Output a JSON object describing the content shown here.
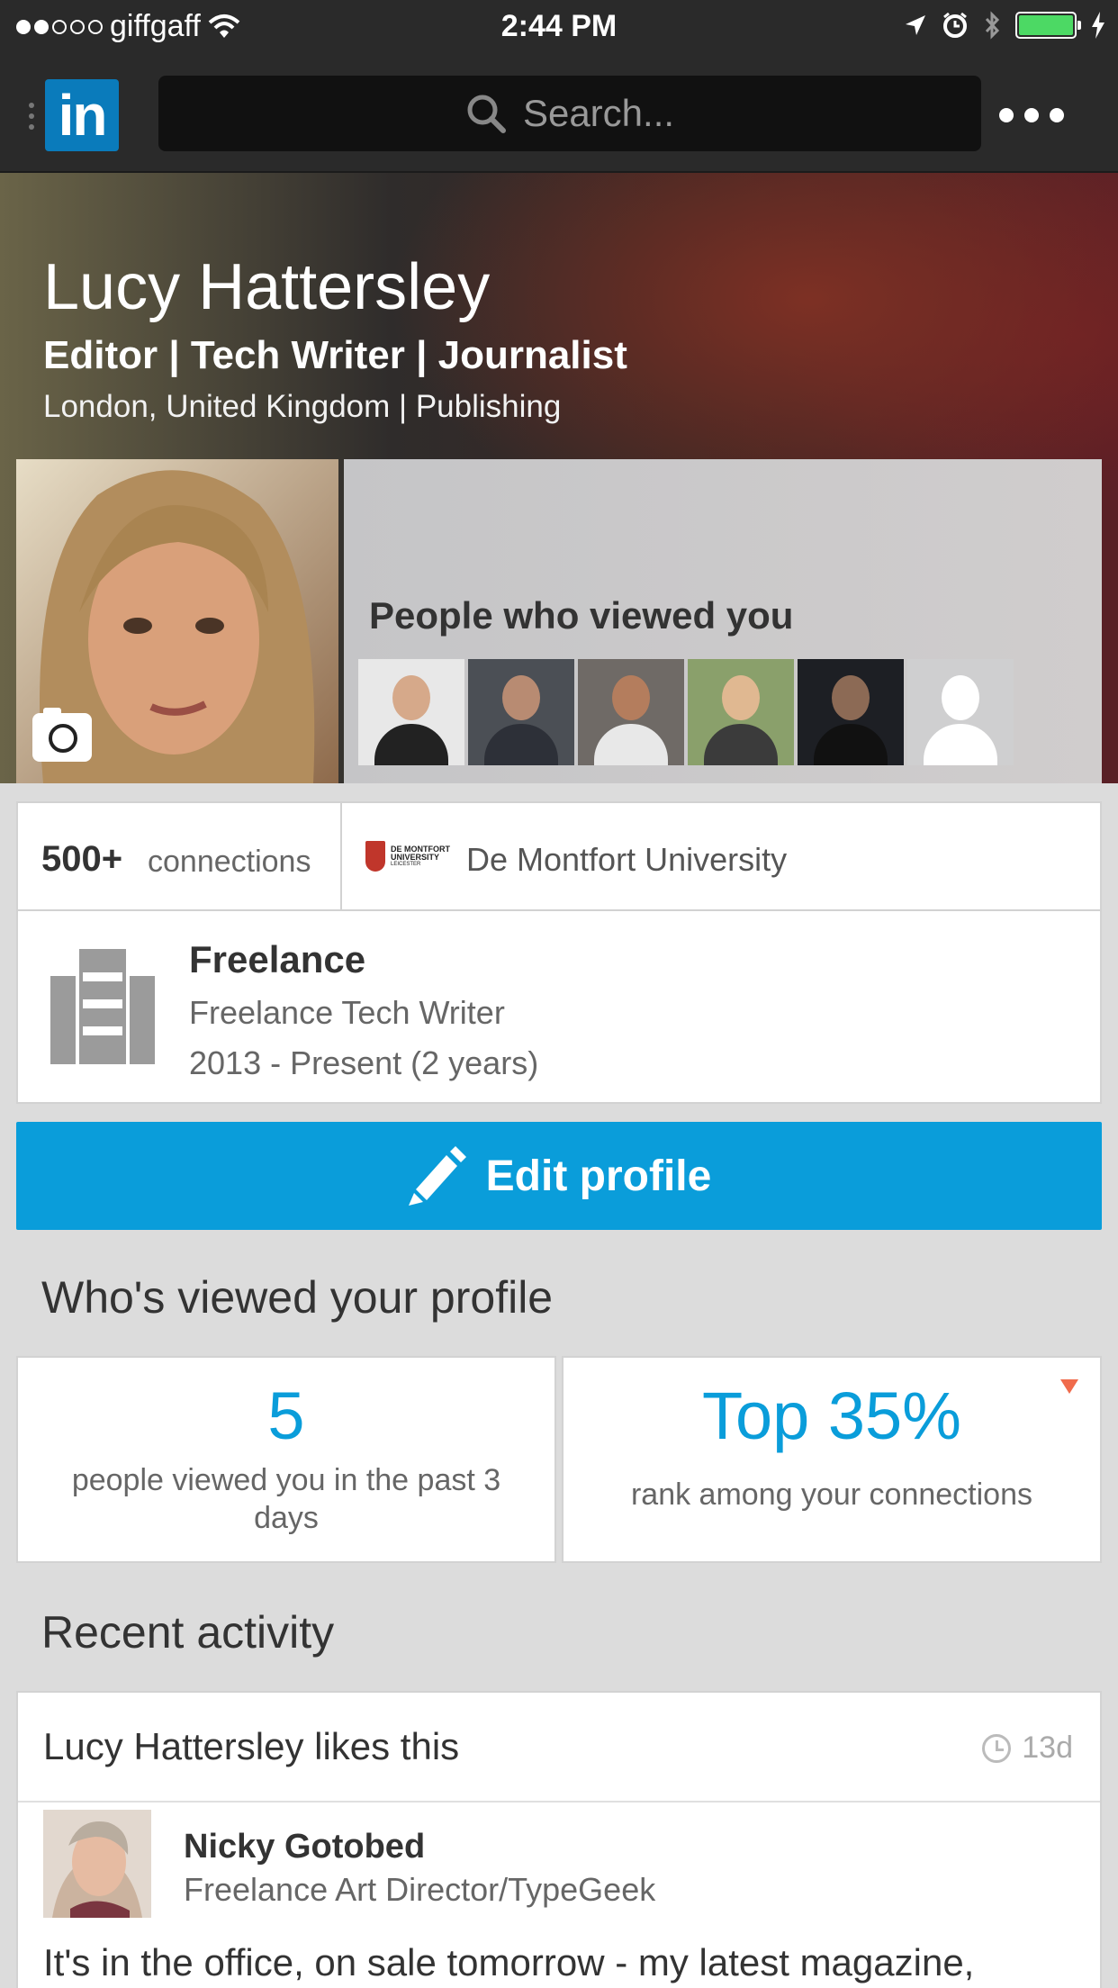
{
  "status_bar": {
    "carrier": "giffgaff",
    "time": "2:44 PM",
    "signal_bars_filled": 2,
    "signal_bars_total": 5,
    "icons": [
      "wifi-icon",
      "location-arrow-icon",
      "alarm-icon",
      "bluetooth-icon",
      "battery-icon",
      "charging-icon"
    ],
    "battery_level": 1.0
  },
  "nav": {
    "logo_text": "in",
    "search_placeholder": "Search...",
    "icons": [
      "grip-icon",
      "search-icon",
      "more-icon"
    ]
  },
  "profile": {
    "name": "Lucy Hattersley",
    "headline": "Editor | Tech Writer | Journalist",
    "location": "London, United Kingdom | Publishing",
    "viewed_title": "People who viewed you",
    "viewer_count_shown": 6
  },
  "summary": {
    "connections_count": "500+",
    "connections_label": "connections",
    "school_logo_lines": [
      "DE MONTFORT",
      "UNIVERSITY",
      "LEICESTER"
    ],
    "school": "De Montfort University"
  },
  "position": {
    "company": "Freelance",
    "title": "Freelance Tech Writer",
    "dates": "2013 - Present (2 years)"
  },
  "edit_button": {
    "label": "Edit profile"
  },
  "whos_viewed": {
    "title": "Who's viewed your profile",
    "views_count": "5",
    "views_label": "people viewed you in the past 3 days",
    "rank_value": "Top 35%",
    "rank_label": "rank among your connections"
  },
  "recent_activity": {
    "title": "Recent activity",
    "item": {
      "actor_text": "Lucy Hattersley likes this",
      "age": "13d",
      "author_name": "Nicky Gotobed",
      "author_title": "Freelance Art Director/TypeGeek",
      "text": "It's in the office, on sale tomorrow - my latest magazine,"
    }
  },
  "colors": {
    "linkedin_blue": "#0a7bbb",
    "accent_blue": "#0a9dda",
    "bar_dark": "#2a2a2a",
    "page_bg": "#dcdcdc",
    "flag_orange": "#f06b4c"
  }
}
